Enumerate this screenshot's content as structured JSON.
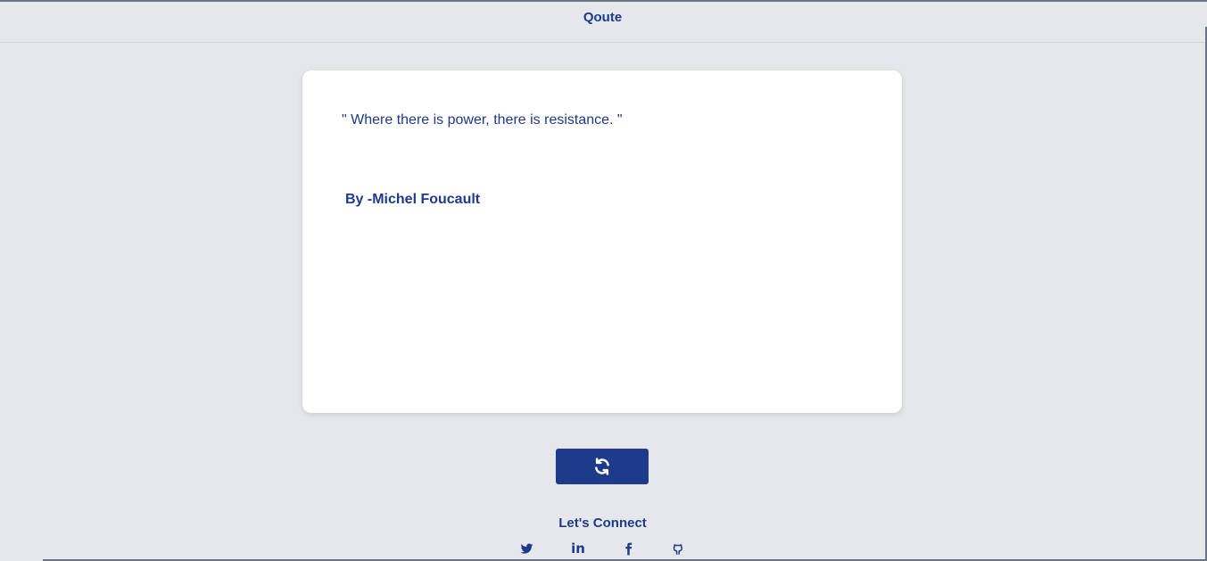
{
  "header": {
    "title": "Qoute"
  },
  "quote": {
    "text": "\" Where there is power, there is resistance. \"",
    "author": "By -Michel Foucault"
  },
  "refresh_button": {
    "icon": "refresh-icon"
  },
  "footer": {
    "connect_label": "Let's Connect",
    "socials": [
      {
        "icon": "twitter-icon"
      },
      {
        "icon": "linkedin-icon",
        "label": "in"
      },
      {
        "icon": "facebook-icon"
      },
      {
        "icon": "github-icon"
      }
    ]
  },
  "colors": {
    "background": "#e5e7eb",
    "accent": "#1e3a8a",
    "card": "#ffffff"
  }
}
